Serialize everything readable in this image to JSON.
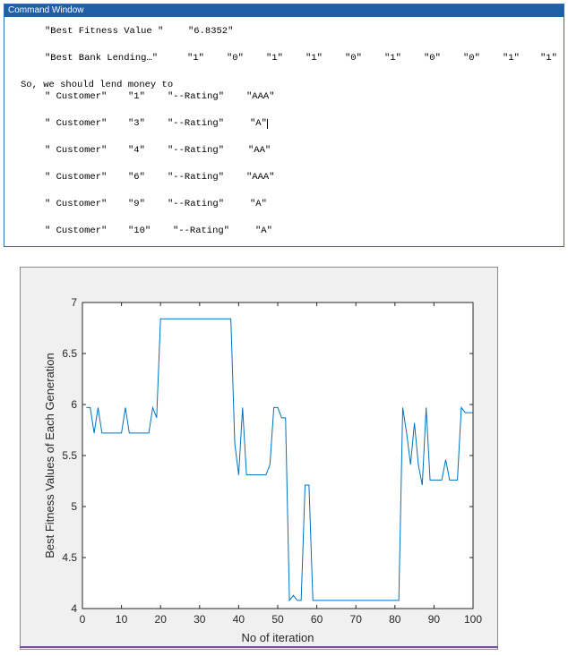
{
  "command_window": {
    "title": "Command Window",
    "best_fitness": {
      "label": "\"Best Fitness Value \"",
      "value": "\"6.8352\""
    },
    "best_lending": {
      "label": "\"Best Bank Lending…\"",
      "bits": [
        "\"1\"",
        "\"0\"",
        "\"1\"",
        "\"1\"",
        "\"0\"",
        "\"1\"",
        "\"0\"",
        "\"0\"",
        "\"1\"",
        "\"1\""
      ]
    },
    "conclusion": "So, we should lend money to",
    "customers": [
      {
        "label": "\" Customer\"",
        "id": "\"1\"",
        "rating_label": "\"--Rating\"",
        "rating": "\"AAA\""
      },
      {
        "label": "\" Customer\"",
        "id": "\"3\"",
        "rating_label": "\"--Rating\"",
        "rating": "\"A\""
      },
      {
        "label": "\" Customer\"",
        "id": "\"4\"",
        "rating_label": "\"--Rating\"",
        "rating": "\"AA\""
      },
      {
        "label": "\" Customer\"",
        "id": "\"6\"",
        "rating_label": "\"--Rating\"",
        "rating": "\"AAA\""
      },
      {
        "label": "\" Customer\"",
        "id": "\"9\"",
        "rating_label": "\"--Rating\"",
        "rating": "\"A\""
      },
      {
        "label": "\" Customer\"",
        "id": "\"10\"",
        "rating_label": "\"--Rating\"",
        "rating": "\"A\""
      }
    ]
  },
  "chart_data": {
    "type": "line",
    "title": "",
    "xlabel": "No of iteration",
    "ylabel": "Best Fitness Values of Each Generation",
    "xlim": [
      0,
      100
    ],
    "ylim": [
      4,
      7
    ],
    "xticks": [
      "0",
      "10",
      "20",
      "30",
      "40",
      "50",
      "60",
      "70",
      "80",
      "90",
      "100"
    ],
    "yticks": [
      "4",
      "4.5",
      "5",
      "5.5",
      "6",
      "6.5",
      "7"
    ],
    "grid": false,
    "line_color": "#0072bd",
    "series": [
      {
        "x": [
          1,
          2,
          3,
          4,
          5,
          6,
          7,
          8,
          9,
          10,
          11,
          12,
          13,
          14,
          15,
          16,
          17,
          18,
          19,
          20,
          21,
          22,
          23,
          24,
          25,
          26,
          27,
          28,
          29,
          30,
          31,
          32,
          33,
          34,
          35,
          36,
          37,
          38,
          39,
          40,
          41,
          42,
          43,
          44,
          45,
          46,
          47,
          48,
          49,
          50,
          51,
          52,
          53,
          54,
          55,
          56,
          57,
          58,
          59,
          60,
          61,
          62,
          63,
          64,
          65,
          66,
          67,
          68,
          69,
          70,
          71,
          72,
          73,
          74,
          75,
          76,
          77,
          78,
          79,
          80,
          81,
          82,
          83,
          84,
          85,
          86,
          87,
          88,
          89,
          90,
          91,
          92,
          93,
          94,
          95,
          96,
          97,
          98,
          99,
          100
        ],
        "values": [
          5.97,
          5.97,
          5.72,
          5.97,
          5.72,
          5.72,
          5.72,
          5.72,
          5.72,
          5.72,
          5.97,
          5.72,
          5.72,
          5.72,
          5.72,
          5.72,
          5.72,
          5.97,
          5.87,
          6.84,
          6.84,
          6.84,
          6.84,
          6.84,
          6.84,
          6.84,
          6.84,
          6.84,
          6.84,
          6.84,
          6.84,
          6.84,
          6.84,
          6.84,
          6.84,
          6.84,
          6.84,
          6.84,
          5.62,
          5.31,
          5.97,
          5.31,
          5.31,
          5.31,
          5.31,
          5.31,
          5.31,
          5.41,
          5.97,
          5.97,
          5.87,
          5.87,
          4.08,
          4.13,
          4.08,
          4.08,
          5.21,
          5.21,
          4.08,
          4.08,
          4.08,
          4.08,
          4.08,
          4.08,
          4.08,
          4.08,
          4.08,
          4.08,
          4.08,
          4.08,
          4.08,
          4.08,
          4.08,
          4.08,
          4.08,
          4.08,
          4.08,
          4.08,
          4.08,
          4.08,
          4.08,
          5.97,
          5.72,
          5.41,
          5.82,
          5.41,
          5.21,
          5.97,
          5.26,
          5.26,
          5.26,
          5.26,
          5.46,
          5.26,
          5.26,
          5.26,
          5.97,
          5.92,
          5.92,
          5.92
        ]
      }
    ]
  }
}
